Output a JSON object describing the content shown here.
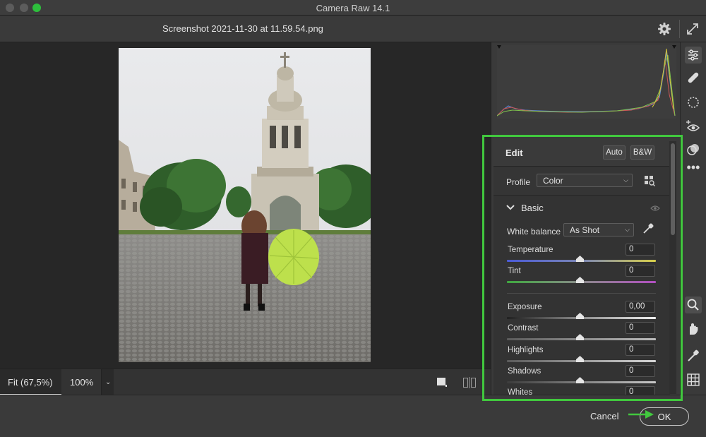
{
  "window": {
    "title": "Camera Raw 14.1"
  },
  "header": {
    "filename": "Screenshot 2021-11-30 at 11.59.54.png"
  },
  "zoom": {
    "fit_label": "Fit (67,5%)",
    "percent_label": "100%"
  },
  "edit": {
    "title": "Edit",
    "auto_label": "Auto",
    "bw_label": "B&W",
    "profile_label": "Profile",
    "profile_value": "Color",
    "section_title": "Basic",
    "white_balance_label": "White balance",
    "white_balance_value": "As Shot",
    "sliders": [
      {
        "label": "Temperature",
        "value": "0"
      },
      {
        "label": "Tint",
        "value": "0"
      },
      {
        "label": "Exposure",
        "value": "0,00"
      },
      {
        "label": "Contrast",
        "value": "0"
      },
      {
        "label": "Highlights",
        "value": "0"
      },
      {
        "label": "Shadows",
        "value": "0"
      },
      {
        "label": "Whites",
        "value": "0"
      }
    ]
  },
  "footer": {
    "cancel_label": "Cancel",
    "ok_label": "OK"
  },
  "tools": [
    "edit-sliders-icon",
    "healing-icon",
    "mask-icon",
    "red-eye-icon",
    "presets-icon",
    "more-icon",
    "zoom-icon",
    "hand-icon",
    "color-sampler-icon",
    "grid-icon"
  ],
  "colors": {
    "accent_highlight": "#41c83e",
    "background": "#2b2b2b",
    "panel": "#3a3a3a"
  }
}
